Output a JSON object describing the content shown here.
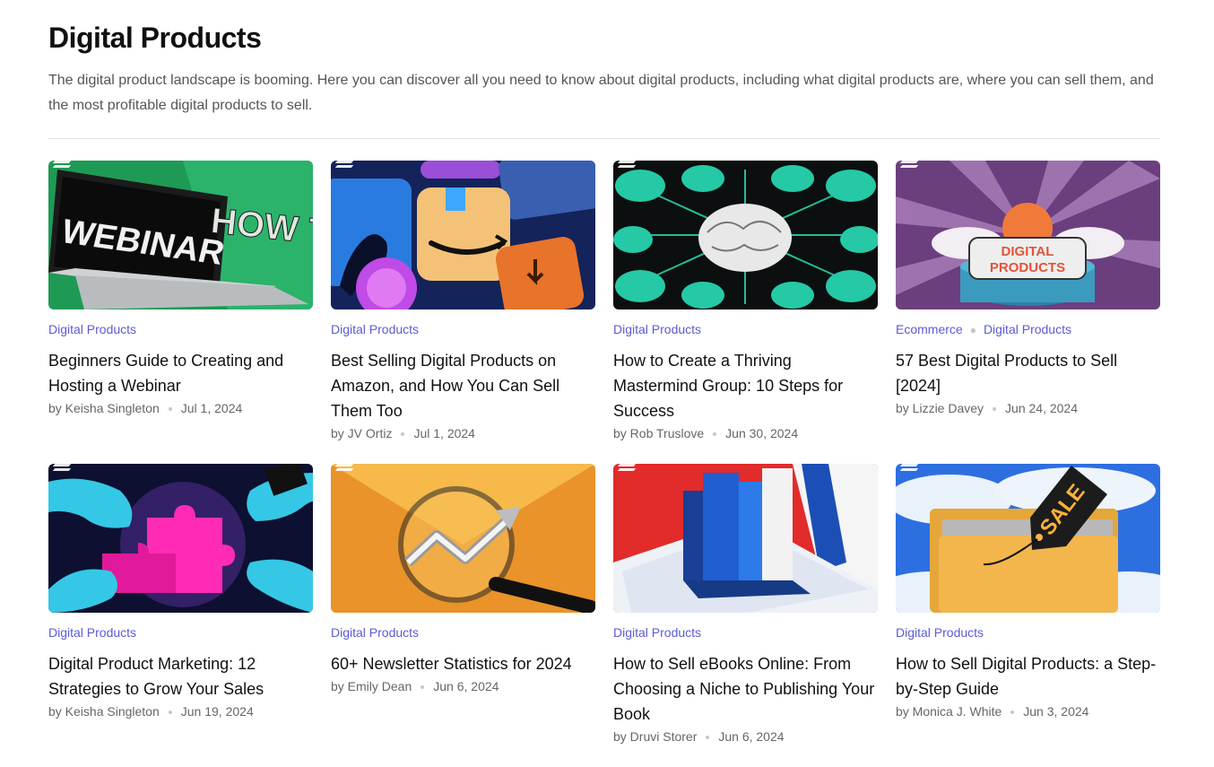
{
  "header": {
    "title": "Digital Products",
    "description": "The digital product landscape is booming. Here you can discover all you need to know about digital products, including what digital products are, where you can sell them, and the most profitable digital products to sell."
  },
  "colors": {
    "category": "#5b5bd6",
    "title": "#111111",
    "meta": "#666666"
  },
  "articles": [
    {
      "categories": [
        "Digital Products"
      ],
      "title": "Beginners Guide to Creating and Hosting a Webinar",
      "author": "by Keisha Singleton",
      "date": "Jul 1, 2024",
      "image_text": [
        "WEBINAR",
        "HOW TO"
      ]
    },
    {
      "categories": [
        "Digital Products"
      ],
      "title": "Best Selling Digital Products on Amazon, and How You Can Sell Them Too",
      "author": "by JV Ortiz",
      "date": "Jul 1, 2024"
    },
    {
      "categories": [
        "Digital Products"
      ],
      "title": "How to Create a Thriving Mastermind Group: 10 Steps for Success",
      "author": "by Rob Truslove",
      "date": "Jun 30, 2024"
    },
    {
      "categories": [
        "Ecommerce",
        "Digital Products"
      ],
      "title": "57 Best Digital Products to Sell [2024]",
      "author": "by Lizzie Davey",
      "date": "Jun 24, 2024",
      "image_text": [
        "DIGITAL",
        "PRODUCTS"
      ]
    },
    {
      "categories": [
        "Digital Products"
      ],
      "title": "Digital Product Marketing: 12 Strategies to Grow Your Sales",
      "author": "by Keisha Singleton",
      "date": "Jun 19, 2024"
    },
    {
      "categories": [
        "Digital Products"
      ],
      "title": "60+ Newsletter Statistics for 2024",
      "author": "by Emily Dean",
      "date": "Jun 6, 2024"
    },
    {
      "categories": [
        "Digital Products"
      ],
      "title": "How to Sell eBooks Online: From Choosing a Niche to Publishing Your Book",
      "author": "by Druvi Storer",
      "date": "Jun 6, 2024"
    },
    {
      "categories": [
        "Digital Products"
      ],
      "title": "How to Sell Digital Products: a Step-by-Step Guide",
      "author": "by Monica J. White",
      "date": "Jun 3, 2024",
      "image_text": [
        "SALE"
      ]
    }
  ]
}
